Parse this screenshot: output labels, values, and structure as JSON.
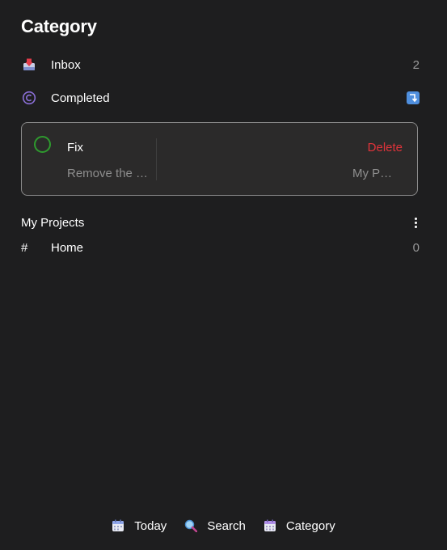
{
  "page": {
    "title": "Category"
  },
  "categories": [
    {
      "label": "Inbox",
      "count": "2",
      "icon": "inbox-tray-icon"
    },
    {
      "label": "Completed",
      "icon": "copyright-circle-icon",
      "badge_icon": "return-arrow-icon"
    }
  ],
  "task": {
    "title": "Fix",
    "description": "Remove the b…",
    "delete_label": "Delete",
    "project": "My Pr…"
  },
  "projects": {
    "title": "My Projects",
    "items": [
      {
        "symbol": "#",
        "label": "Home",
        "count": "0"
      }
    ]
  },
  "nav": [
    {
      "label": "Today",
      "icon": "calendar-icon"
    },
    {
      "label": "Search",
      "icon": "magnifier-icon"
    },
    {
      "label": "Category",
      "icon": "calendar-grid-icon"
    }
  ],
  "colors": {
    "background": "#1e1e1f",
    "card": "#2b2a2a",
    "accent_green": "#2e9a2e",
    "delete_red": "#e0333a",
    "muted": "#8e8e8e"
  }
}
